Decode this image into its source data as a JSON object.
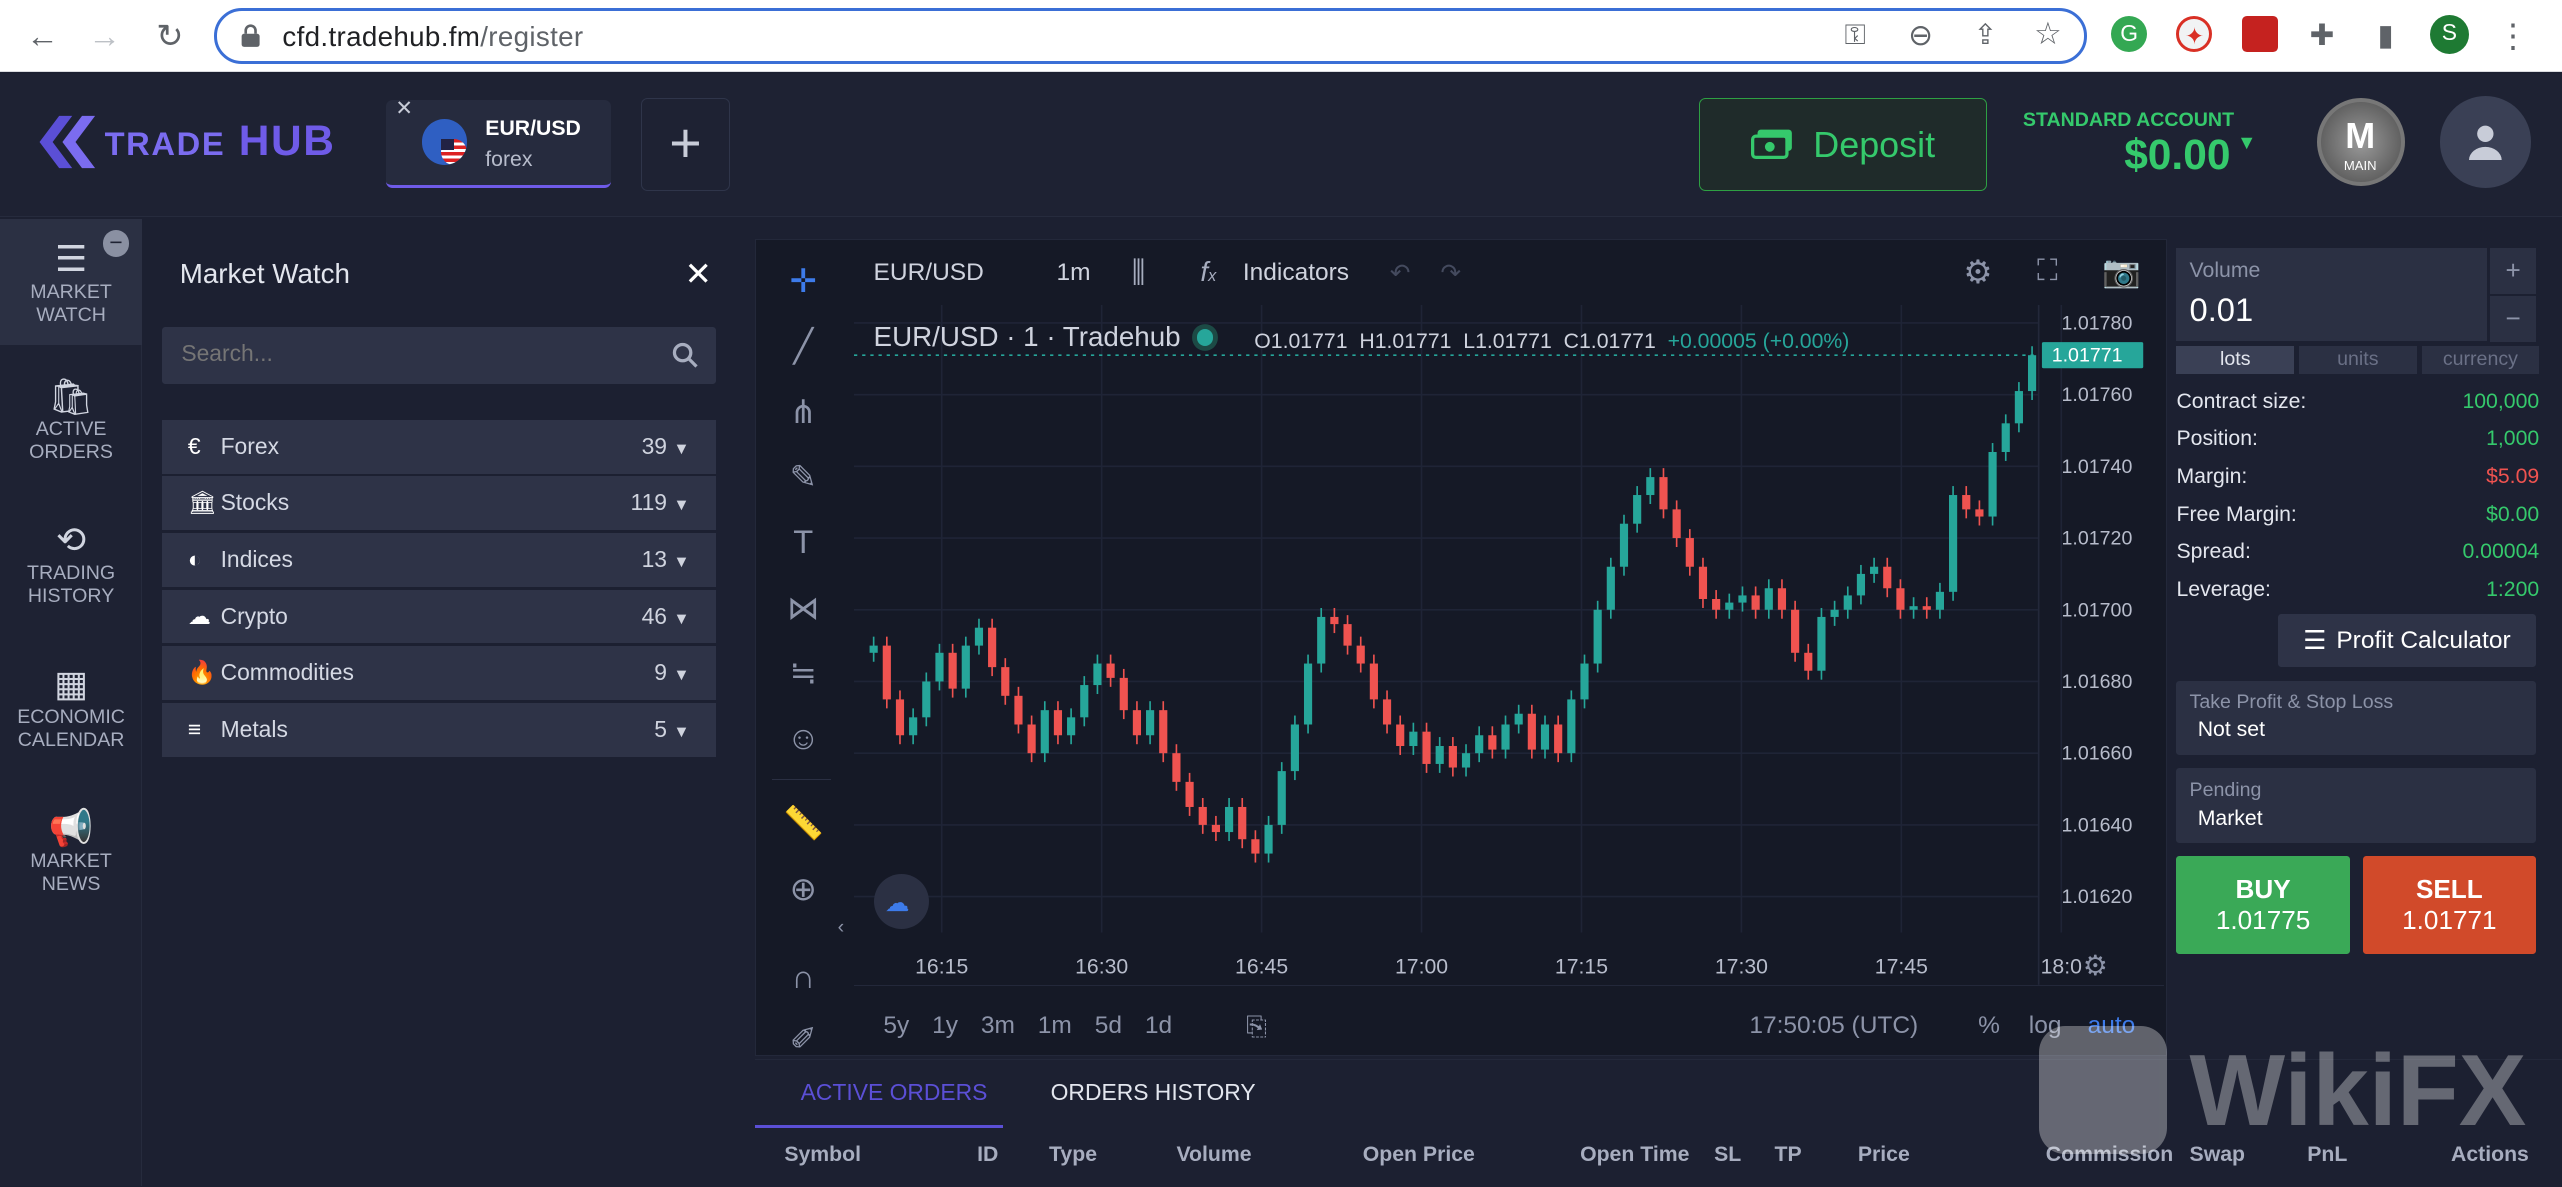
{
  "browser": {
    "url_host": "cfd.tradehub.fm",
    "url_path": "/register",
    "profile_initial": "S"
  },
  "header": {
    "logo_prefix": "TRADE",
    "logo_main": "HUB",
    "tab_symbol": "EUR/USD",
    "tab_market": "forex",
    "add_tab": "+",
    "deposit_label": "Deposit",
    "account_type": "STANDARD ACCOUNT",
    "balance": "$0.00",
    "badge_text": "MAIN"
  },
  "rail": {
    "items": [
      {
        "label1": "MARKET",
        "label2": "WATCH"
      },
      {
        "label1": "ACTIVE",
        "label2": "ORDERS"
      },
      {
        "label1": "TRADING",
        "label2": "HISTORY"
      },
      {
        "label1": "ECONOMIC",
        "label2": "CALENDAR"
      },
      {
        "label1": "MARKET",
        "label2": "NEWS"
      }
    ]
  },
  "market_watch": {
    "title": "Market Watch",
    "search_placeholder": "Search...",
    "categories": [
      {
        "label": "Forex",
        "count": "39",
        "icon": "€"
      },
      {
        "label": "Stocks",
        "count": "119",
        "icon": "🏛"
      },
      {
        "label": "Indices",
        "count": "13",
        "icon": "◐"
      },
      {
        "label": "Crypto",
        "count": "46",
        "icon": "☁"
      },
      {
        "label": "Commodities",
        "count": "9",
        "icon": "🔥"
      },
      {
        "label": "Metals",
        "count": "5",
        "icon": "≡"
      }
    ]
  },
  "chart_toolbar": {
    "symbol": "EUR/USD",
    "interval": "1m",
    "indicators": "Indicators"
  },
  "chart_legend": {
    "title": "EUR/USD · 1 · Tradehub",
    "o": "O1.01771",
    "h": "H1.01771",
    "l": "L1.01771",
    "c": "C1.01771",
    "change": "+0.00005 (+0.00%)"
  },
  "chart_footer": {
    "ranges": [
      "5y",
      "1y",
      "3m",
      "1m",
      "5d",
      "1d"
    ],
    "time": "17:50:05 (UTC)",
    "pct": "%",
    "log": "log",
    "auto": "auto"
  },
  "chart_data": {
    "type": "candlestick",
    "x_ticks": [
      "16:15",
      "16:30",
      "16:45",
      "17:00",
      "17:15",
      "17:30",
      "17:45",
      "18:0"
    ],
    "y_ticks": [
      "1.01780",
      "1.01760",
      "1.01740",
      "1.01720",
      "1.01700",
      "1.01680",
      "1.01660",
      "1.01640",
      "1.01620"
    ],
    "ylim": [
      1.0161,
      1.01785
    ],
    "last_price": "1.01771",
    "up_color": "#26a69a",
    "down_color": "#ef5350",
    "closes": [
      1.0169,
      1.01675,
      1.01665,
      1.0167,
      1.0168,
      1.01688,
      1.01678,
      1.0169,
      1.01695,
      1.01684,
      1.01676,
      1.01668,
      1.0166,
      1.01672,
      1.01665,
      1.0167,
      1.01679,
      1.01685,
      1.01681,
      1.01672,
      1.01665,
      1.01672,
      1.0166,
      1.01652,
      1.01645,
      1.0164,
      1.01638,
      1.01645,
      1.01636,
      1.01632,
      1.0164,
      1.01655,
      1.01668,
      1.01685,
      1.01698,
      1.01696,
      1.0169,
      1.01685,
      1.01675,
      1.01668,
      1.01662,
      1.01666,
      1.01657,
      1.01662,
      1.01656,
      1.0166,
      1.01665,
      1.01661,
      1.01668,
      1.01671,
      1.01661,
      1.01668,
      1.0166,
      1.01675,
      1.01685,
      1.017,
      1.01712,
      1.01724,
      1.01732,
      1.01737,
      1.01728,
      1.0172,
      1.01712,
      1.01703,
      1.017,
      1.01702,
      1.01704,
      1.017,
      1.01706,
      1.017,
      1.01688,
      1.01683,
      1.01698,
      1.017,
      1.01704,
      1.0171,
      1.01712,
      1.01706,
      1.017,
      1.01701,
      1.017,
      1.01705,
      1.01732,
      1.01728,
      1.01726,
      1.01744,
      1.01752,
      1.01761,
      1.01771
    ]
  },
  "trade_panel": {
    "volume_label": "Volume",
    "volume_value": "0.01",
    "units": [
      "lots",
      "units",
      "currency"
    ],
    "info": [
      {
        "label": "Contract size:",
        "value": "100,000",
        "color": "#35c96c"
      },
      {
        "label": "Position:",
        "value": "1,000",
        "color": "#35c96c"
      },
      {
        "label": "Margin:",
        "value": "$5.09",
        "color": "#ef5350"
      },
      {
        "label": "Free Margin:",
        "value": "$0.00",
        "color": "#35c96c"
      },
      {
        "label": "Spread:",
        "value": "0.00004",
        "color": "#35c96c"
      },
      {
        "label": "Leverage:",
        "value": "1:200",
        "color": "#35c96c"
      }
    ],
    "profit_calc": "Profit Calculator",
    "tpsl_label": "Take Profit & Stop Loss",
    "tpsl_value": "Not set",
    "pending_label": "Pending",
    "pending_value": "Market",
    "buy_label": "BUY",
    "buy_price": "1.01775",
    "sell_label": "SELL",
    "sell_price": "1.01771"
  },
  "orders": {
    "tab_active": "ACTIVE ORDERS",
    "tab_history": "ORDERS HISTORY",
    "columns": [
      "Symbol",
      "ID",
      "Type",
      "Volume",
      "Open Price",
      "Open Time",
      "SL",
      "TP",
      "Price",
      "Commission",
      "Swap",
      "PnL",
      "Actions"
    ]
  },
  "watermark": "WikiFX"
}
